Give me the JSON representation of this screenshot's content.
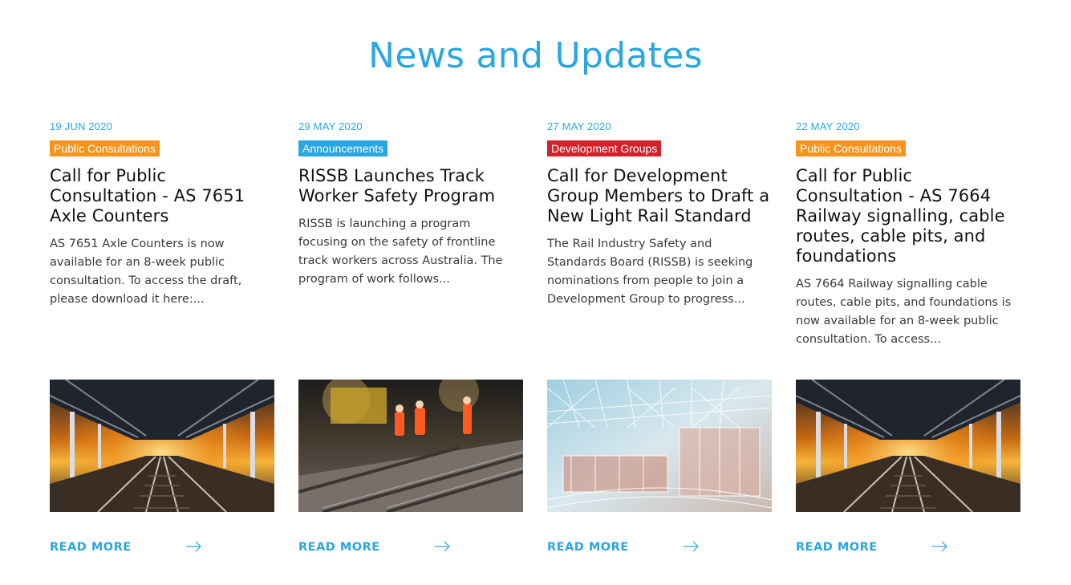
{
  "section_title": "News and Updates",
  "colors": {
    "accent": "#2aa6e0",
    "tag_public_consultations": "#f7941d",
    "tag_announcements": "#2aa6e0",
    "tag_development_groups": "#d2232a"
  },
  "cards": [
    {
      "date": "19 JUN 2020",
      "tag": "Public Consultations",
      "title": "Call for Public Consultation - AS 7651 Axle Counters",
      "excerpt": "AS 7651 Axle Counters is now available for an 8-week public consultation.  To access the draft, please download it here:...",
      "image": "railway-station-platform-night",
      "read_more": "READ MORE",
      "arrow_icon": "arrow-right-icon"
    },
    {
      "date": "29 MAY 2020",
      "tag": "Announcements",
      "title": "RISSB Launches Track Worker Safety Program",
      "excerpt": "RISSB is launching a program focusing on the safety of frontline track workers across Australia. The program of work follows...",
      "image": "track-workers-night",
      "read_more": "READ MORE",
      "arrow_icon": "arrow-right-icon"
    },
    {
      "date": "27 MAY 2020",
      "tag": "Development Groups",
      "title": "Call for Development Group Members to Draft a New Light Rail Standard",
      "excerpt": "The Rail Industry Safety and Standards Board (RISSB) is seeking nominations from people to join a Development Group to progress...",
      "image": "light-rail-wireframe",
      "read_more": "READ MORE",
      "arrow_icon": "arrow-right-icon"
    },
    {
      "date": "22 MAY 2020",
      "tag": "Public Consultations",
      "title": "Call for Public Consultation - AS 7664 Railway signalling, cable routes, cable pits, and foundations",
      "excerpt": "AS 7664 Railway signalling cable routes, cable pits, and foundations is now available for an 8-week public consultation.  To access...",
      "image": "railway-station-platform-night",
      "read_more": "READ MORE",
      "arrow_icon": "arrow-right-icon"
    }
  ]
}
